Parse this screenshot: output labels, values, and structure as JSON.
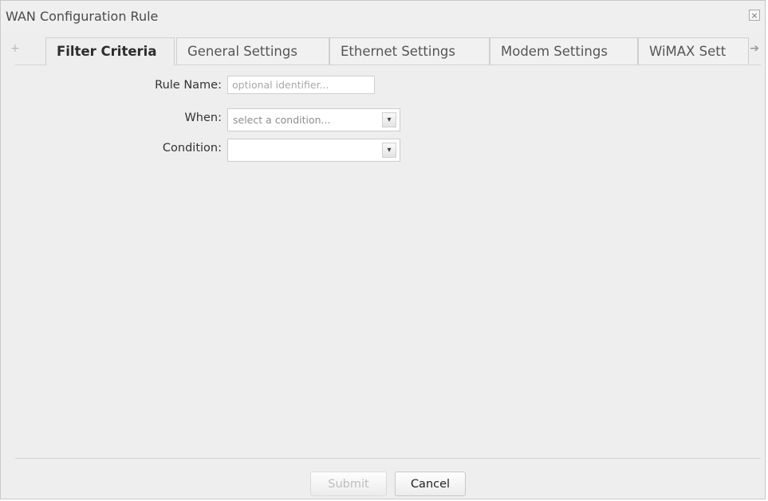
{
  "dialog": {
    "title": "WAN Configuration Rule",
    "close_label": "×"
  },
  "tabs": {
    "scroll_left": "+",
    "scroll_right": "➔",
    "items": [
      {
        "label": "Filter Criteria",
        "active": true
      },
      {
        "label": "General Settings",
        "active": false
      },
      {
        "label": "Ethernet Settings",
        "active": false
      },
      {
        "label": "Modem Settings",
        "active": false
      },
      {
        "label": "WiMAX Sett",
        "active": false
      }
    ]
  },
  "form": {
    "rule_name": {
      "label": "Rule Name:",
      "value": "",
      "placeholder": "optional identifier..."
    },
    "when": {
      "label": "When:",
      "value": "select a condition...",
      "arrow": "▾"
    },
    "condition": {
      "label": "Condition:",
      "value": "",
      "arrow": "▾"
    }
  },
  "footer": {
    "submit_label": "Submit",
    "cancel_label": "Cancel"
  },
  "colors": {
    "panel_bg": "#eeeeee",
    "border": "#cfcfcf",
    "disabled_text": "#bdbdbd"
  }
}
